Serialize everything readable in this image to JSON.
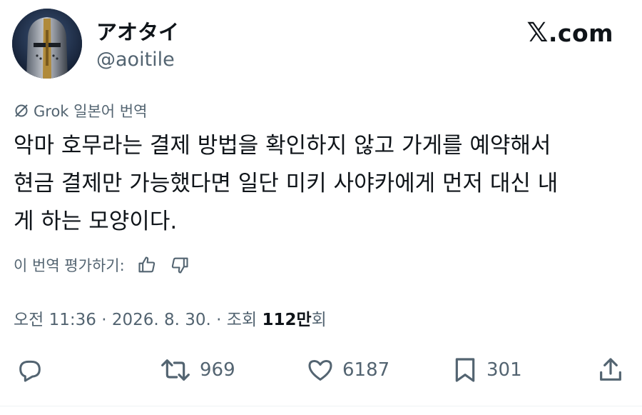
{
  "author": {
    "display_name": "アオタイ",
    "handle": "@aoitile"
  },
  "brand": {
    "x_glyph": "𝕏",
    "suffix": ".com"
  },
  "translation": {
    "label": "Grok 일본어 번역",
    "icon": "grok-icon"
  },
  "tweet": {
    "lines": [
      "악마 호무라는 결제 방법을 확인하지 않고 가게를 예약해서",
      "현금 결제만 가능했다면 일단 미키 사야카에게 먼저 대신 내",
      "게 하는 모양이다."
    ]
  },
  "rating": {
    "label": "이 번역 평가하기:",
    "up_icon": "thumbs-up-icon",
    "down_icon": "thumbs-down-icon"
  },
  "meta": {
    "time": "오전 11:36",
    "separator1": " · ",
    "date": "2026. 8. 30.",
    "separator2": " · ",
    "views_prefix": "조회 ",
    "views_count": "112만",
    "views_suffix": "회"
  },
  "actions": {
    "reply": {
      "icon": "reply-icon"
    },
    "retweet": {
      "icon": "retweet-icon",
      "count": "969"
    },
    "like": {
      "icon": "heart-icon",
      "count": "6187"
    },
    "bookmark": {
      "icon": "bookmark-icon",
      "count": "301"
    },
    "share": {
      "icon": "share-icon"
    }
  },
  "colors": {
    "text": "#0f1419",
    "secondary": "#536471",
    "divider": "#eff3f4"
  }
}
